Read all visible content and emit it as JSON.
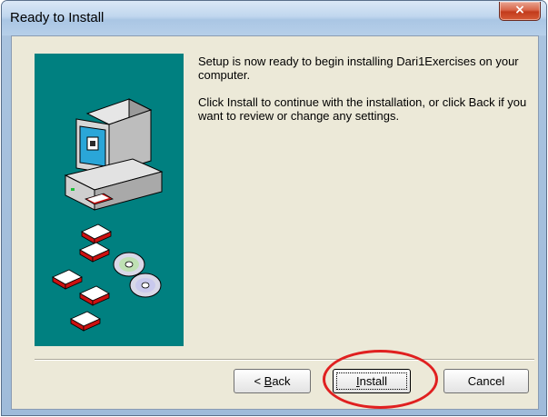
{
  "window": {
    "title": "Ready to Install",
    "close_glyph": "×"
  },
  "message": {
    "paragraph1": "Setup is now ready to begin installing Dari1Exercises on your computer.",
    "paragraph2": "Click Install to continue with the installation, or click Back if you want to review or change any settings."
  },
  "buttons": {
    "back": {
      "prefix": "< ",
      "mnemonic": "B",
      "rest": "ack"
    },
    "install": {
      "mnemonic": "I",
      "rest": "nstall"
    },
    "cancel": "Cancel"
  },
  "annotation": {
    "color": "#e02020"
  },
  "illustration": {
    "background": "#008080",
    "icons": [
      "computer-icon",
      "floppy-disk-icon",
      "cd-disc-icon"
    ]
  }
}
